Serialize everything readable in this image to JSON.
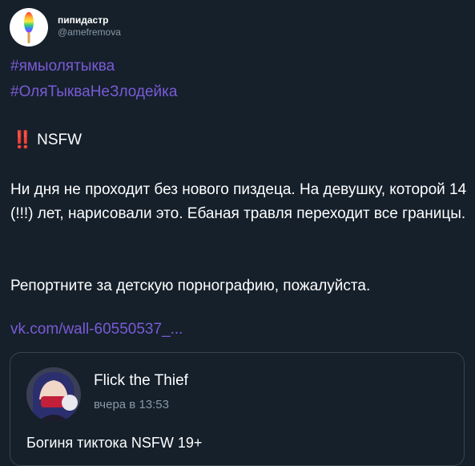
{
  "author": {
    "display_name": "пипидастр",
    "handle": "@amefremova"
  },
  "hashtags": [
    "#ямыолятыква",
    "#ОляТыкваНеЗлодейка"
  ],
  "nsfw": {
    "marker": "‼️",
    "label": "NSFW"
  },
  "body_paragraph": "Ни дня не проходит без нового пиздеца. На девушку, которой 14 (!!!) лет, нарисовали это. Ебаная травля переходит все границы.",
  "report_paragraph": "Репортните за детскую порнографию, пожалуйста.",
  "link_text": "vk.com/wall-60550537_...",
  "card": {
    "name": "Flick the Thief",
    "time": "вчера в 13:53",
    "title": "Богиня тиктока NSFW 19+"
  },
  "colors": {
    "background": "#15202b",
    "link": "#7a5bd6",
    "secondary_text": "#8899a6",
    "alert": "#e0245e",
    "card_border": "#38444d"
  }
}
